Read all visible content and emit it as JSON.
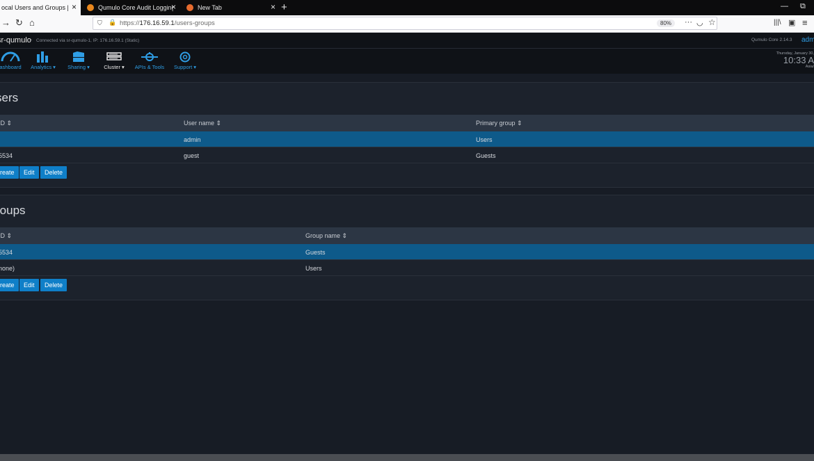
{
  "browser": {
    "tabs": [
      {
        "label": "ocal Users and Groups | sr-qu",
        "active": true
      },
      {
        "label": "Qumulo Core Audit Logging -",
        "active": false
      },
      {
        "label": "New Tab",
        "active": false
      }
    ],
    "url_host": "176.16.59.1",
    "url_prefix": "https://",
    "url_path": "/users-groups",
    "zoom": "80%"
  },
  "app": {
    "cluster_name": "sr-qumulo",
    "connection": "Connected via sr-qumulo-1, IP: 176.16.59.1 (Static)",
    "version": "Qumulo Core 2.14.3",
    "user": "adm",
    "clock_date": "Thursday, January 30,",
    "clock_time": "10:33 A",
    "clock_zone": "Asia/",
    "nav": [
      {
        "label": "ashboard",
        "icon": "dashboard-gauge-icon"
      },
      {
        "label": "Analytics ▾",
        "icon": "analytics-bar-chart-icon"
      },
      {
        "label": "Sharing ▾",
        "icon": "sharing-folders-icon"
      },
      {
        "label": "Cluster ▾",
        "icon": "cluster-server-icon"
      },
      {
        "label": "APIs & Tools",
        "icon": "api-tools-icon"
      },
      {
        "label": "Support ▾",
        "icon": "support-lifebuoy-icon"
      }
    ]
  },
  "users": {
    "title": "sers",
    "columns": [
      "ID ⇕",
      "User name ⇕",
      "Primary group ⇕"
    ],
    "rows": [
      {
        "id": "",
        "name": "admin",
        "group": "Users",
        "selected": true
      },
      {
        "id": "5534",
        "name": "guest",
        "group": "Guests",
        "selected": false
      }
    ],
    "buttons": {
      "create": "reate",
      "edit": "Edit",
      "delete": "Delete"
    }
  },
  "groups": {
    "title": "roups",
    "columns": [
      "ID ⇕",
      "Group name ⇕"
    ],
    "rows": [
      {
        "id": "5534",
        "name": "Guests",
        "selected": true
      },
      {
        "id": "none)",
        "name": "Users",
        "selected": false
      }
    ],
    "buttons": {
      "create": "reate",
      "edit": "Edit",
      "delete": "Delete"
    }
  }
}
